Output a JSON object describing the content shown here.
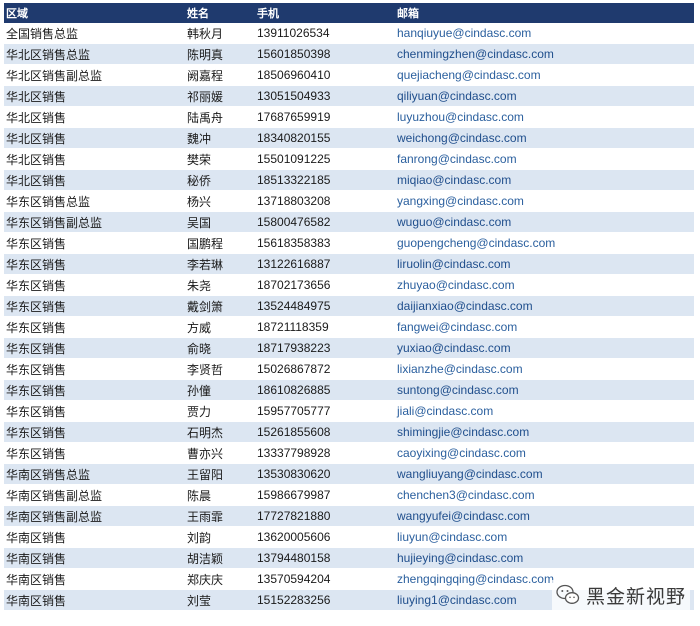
{
  "table": {
    "headers": [
      "区域",
      "姓名",
      "手机",
      "邮箱"
    ],
    "rows": [
      [
        "全国销售总监",
        "韩秋月",
        "13911026534",
        "hanqiuyue@cindasc.com"
      ],
      [
        "华北区销售总监",
        "陈明真",
        "15601850398",
        "chenmingzhen@cindasc.com"
      ],
      [
        "华北区销售副总监",
        "阙嘉程",
        "18506960410",
        "quejiacheng@cindasc.com"
      ],
      [
        "华北区销售",
        "祁丽媛",
        "13051504933",
        "qiliyuan@cindasc.com"
      ],
      [
        "华北区销售",
        "陆禹舟",
        "17687659919",
        "luyuzhou@cindasc.com"
      ],
      [
        "华北区销售",
        "魏冲",
        "18340820155",
        "weichong@cindasc.com"
      ],
      [
        "华北区销售",
        "樊荣",
        "15501091225",
        "fanrong@cindasc.com"
      ],
      [
        "华北区销售",
        "秘侨",
        "18513322185",
        "miqiao@cindasc.com"
      ],
      [
        "华东区销售总监",
        "杨兴",
        "13718803208",
        "yangxing@cindasc.com"
      ],
      [
        "华东区销售副总监",
        "吴国",
        "15800476582",
        "wuguo@cindasc.com"
      ],
      [
        "华东区销售",
        "国鹏程",
        "15618358383",
        "guopengcheng@cindasc.com"
      ],
      [
        "华东区销售",
        "李若琳",
        "13122616887",
        "liruolin@cindasc.com"
      ],
      [
        "华东区销售",
        "朱尧",
        "18702173656",
        "zhuyao@cindasc.com"
      ],
      [
        "华东区销售",
        "戴剑箫",
        "13524484975",
        "daijianxiao@cindasc.com"
      ],
      [
        "华东区销售",
        "方威",
        "18721118359",
        "fangwei@cindasc.com"
      ],
      [
        "华东区销售",
        "俞晓",
        "18717938223",
        "yuxiao@cindasc.com"
      ],
      [
        "华东区销售",
        "李贤哲",
        "15026867872",
        "lixianzhe@cindasc.com"
      ],
      [
        "华东区销售",
        "孙僮",
        "18610826885",
        "suntong@cindasc.com"
      ],
      [
        "华东区销售",
        "贾力",
        "15957705777",
        "jiali@cindasc.com"
      ],
      [
        "华东区销售",
        "石明杰",
        "15261855608",
        "shimingjie@cindasc.com"
      ],
      [
        "华东区销售",
        "曹亦兴",
        "13337798928",
        "caoyixing@cindasc.com"
      ],
      [
        "华南区销售总监",
        "王留阳",
        "13530830620",
        "wangliuyang@cindasc.com"
      ],
      [
        "华南区销售副总监",
        "陈晨",
        "15986679987",
        "chenchen3@cindasc.com"
      ],
      [
        "华南区销售副总监",
        "王雨霏",
        "17727821880",
        "wangyufei@cindasc.com"
      ],
      [
        "华南区销售",
        "刘韵",
        "13620005606",
        "liuyun@cindasc.com"
      ],
      [
        "华南区销售",
        "胡洁颖",
        "13794480158",
        "hujieying@cindasc.com"
      ],
      [
        "华南区销售",
        "郑庆庆",
        "13570594204",
        "zhengqingqing@cindasc.com"
      ],
      [
        "华南区销售",
        "刘莹",
        "15152283256",
        "liuying1@cindasc.com"
      ]
    ]
  },
  "watermark": {
    "text": "黑金新视野",
    "icon": "wechat-icon"
  },
  "colors": {
    "header_bg": "#1f3a6e",
    "stripe_bg": "#dce6f2",
    "link": "#1f4e8c"
  }
}
